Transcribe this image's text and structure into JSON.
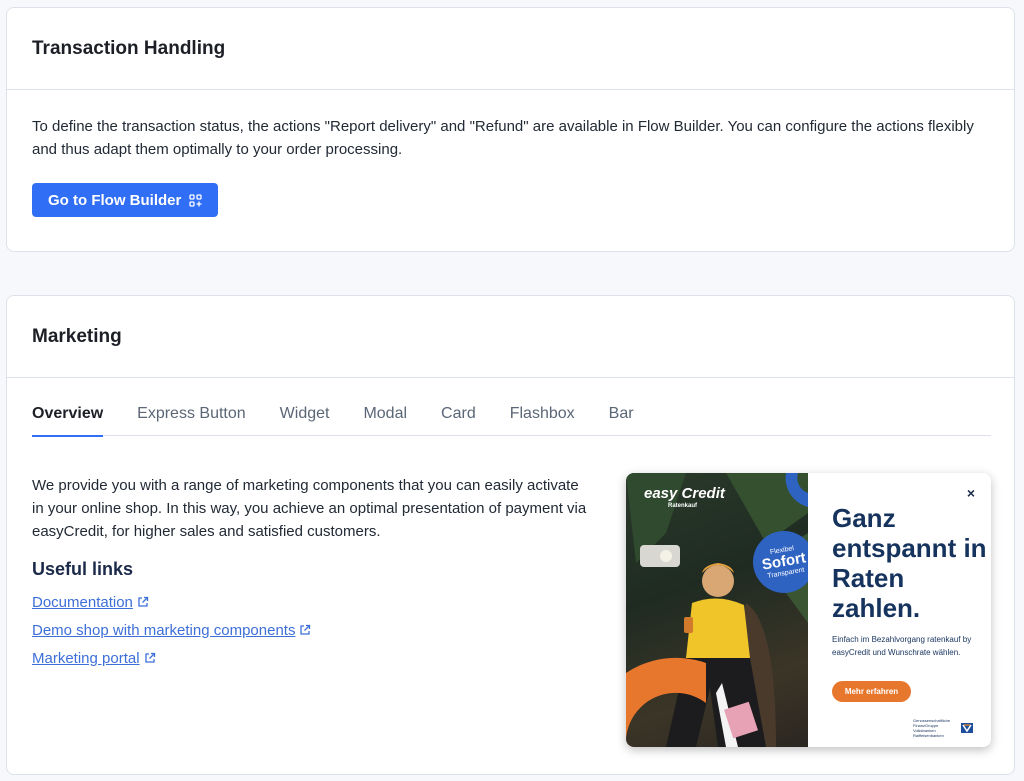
{
  "transaction": {
    "title": "Transaction Handling",
    "description": "To define the transaction status, the actions \"Report delivery\" and \"Refund\" are available in Flow Builder. You can configure the actions flexibly and thus adapt them optimally to your order processing.",
    "button_label": "Go to Flow Builder",
    "button_icon": "flow-builder-icon"
  },
  "marketing": {
    "title": "Marketing",
    "tabs": [
      {
        "label": "Overview",
        "active": true
      },
      {
        "label": "Express Button",
        "active": false
      },
      {
        "label": "Widget",
        "active": false
      },
      {
        "label": "Modal",
        "active": false
      },
      {
        "label": "Card",
        "active": false
      },
      {
        "label": "Flashbox",
        "active": false
      },
      {
        "label": "Bar",
        "active": false
      }
    ],
    "description": "We provide you with a range of marketing components that you can easily activate in your online shop. In this way, you achieve an optimal presentation of payment via easyCredit, for higher sales and satisfied customers.",
    "useful_links_title": "Useful links",
    "links": [
      {
        "label": "Documentation",
        "icon": "external-link-icon"
      },
      {
        "label": "Demo shop with marketing components",
        "icon": "external-link-icon"
      },
      {
        "label": "Marketing portal",
        "icon": "external-link-icon"
      }
    ]
  },
  "banner": {
    "logo_main": "easy Credit",
    "logo_sub": "Ratenkauf",
    "badge_top": "Flexibel",
    "badge_main": "Sofort",
    "badge_bottom": "Transparent",
    "headline": "Ganz entspannt in Raten zahlen.",
    "subtext": "Einfach im Bezahlvorgang ratenkauf by easyCredit und Wunschrate wählen.",
    "button_label": "Mehr erfahren",
    "footer_text": "Genossenschaftliche FinanzGruppe Volksbanken Raiffeisenbanken",
    "close_symbol": "×"
  },
  "colors": {
    "primary": "#2f6ef5",
    "link": "#3d6fd8",
    "banner_orange": "#e8772e",
    "banner_blue": "#16335e",
    "badge_blue": "#2e63c2"
  }
}
